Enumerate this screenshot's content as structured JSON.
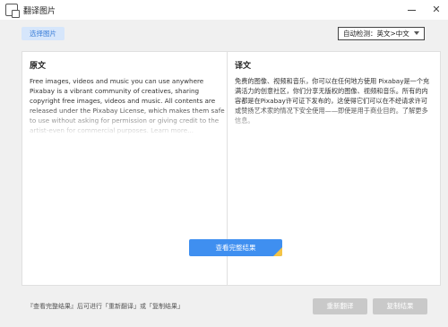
{
  "window": {
    "title": "翻译图片",
    "minimize_icon": "minimize-icon",
    "close_symbol": "✕"
  },
  "toolbar": {
    "select_image_label": "选择图片",
    "language_selected": "自动检测：英文>中文"
  },
  "source_panel": {
    "heading": "原文",
    "text": "Free images, videos and music you can use anywhere Pixabay is a vibrant community of creatives, sharing copyright free images, videos and music. All contents are released under the Pixabay License, which makes them safe to use without asking for permission or giving credit to the artist-even for commercial purposes. Learn more..."
  },
  "target_panel": {
    "heading": "译文",
    "text": "免费的图像、视频和音乐，你可以在任何地方使用 Pixabay是一个充满活力的创意社区，你们分享无版权的图像、视频和音乐。所有的内容都是在Pixabay许可证下发布的，这使得它们可以在不经请求许可或赞扬艺术家的情况下安全使用——即使是用于商业目的。了解更多信息。"
  },
  "view_full_label": "查看完整结果",
  "footer": {
    "hint": "『查看完整结果』后可进行「重新翻译」或「复制结果」",
    "retranslate_label": "重新翻译",
    "copy_label": "复制结果"
  }
}
